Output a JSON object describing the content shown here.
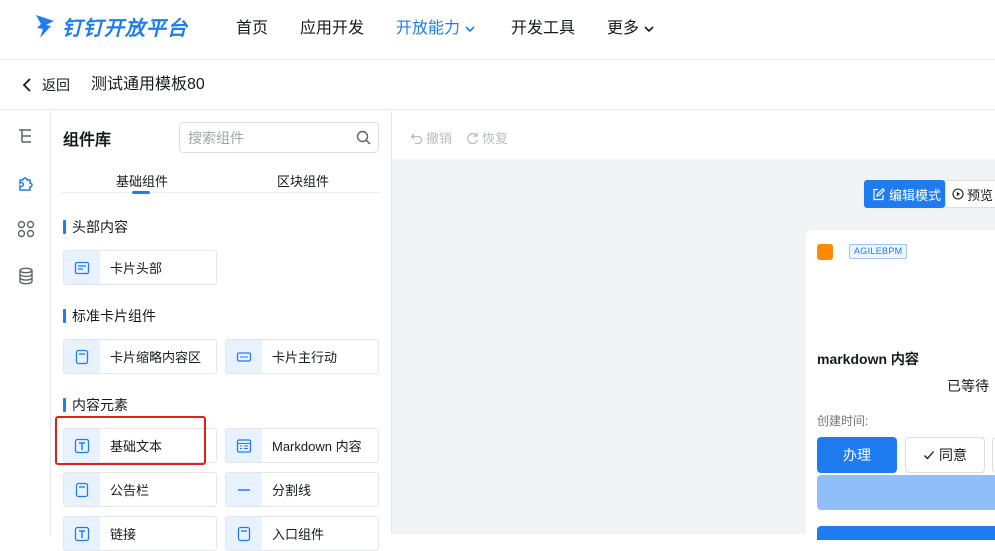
{
  "brand": {
    "name": "钉钉开放平台",
    "color": "#1f7cf0"
  },
  "nav": {
    "items": [
      {
        "label": "首页",
        "active": false
      },
      {
        "label": "应用开发",
        "active": false
      },
      {
        "label": "开放能力",
        "active": true,
        "dropdown": true
      },
      {
        "label": "开发工具",
        "active": false
      },
      {
        "label": "更多",
        "active": false,
        "dropdown": true
      }
    ]
  },
  "subheader": {
    "back_label": "返回",
    "title": "测试通用模板80"
  },
  "rail": {
    "icons": [
      "tree-outline-icon",
      "puzzle-icon",
      "grid-apps-icon",
      "database-icon"
    ]
  },
  "panel": {
    "title": "组件库",
    "search_placeholder": "搜索组件",
    "tabs": [
      {
        "label": "基础组件",
        "active": true
      },
      {
        "label": "区块组件",
        "active": false
      }
    ],
    "sections": [
      {
        "heading": "头部内容",
        "items": [
          {
            "label": "卡片头部",
            "icon": "card-header-icon"
          }
        ]
      },
      {
        "heading": "标准卡片组件",
        "items": [
          {
            "label": "卡片缩略内容区",
            "icon": "card-summary-icon"
          },
          {
            "label": "卡片主行动",
            "icon": "button-icon"
          }
        ]
      },
      {
        "heading": "内容元素",
        "items": [
          {
            "label": "基础文本",
            "icon": "text-icon"
          },
          {
            "label": "Markdown 内容",
            "icon": "markdown-icon"
          },
          {
            "label": "公告栏",
            "icon": "notice-icon"
          },
          {
            "label": "分割线",
            "icon": "divider-icon"
          },
          {
            "label": "链接",
            "icon": "link-icon"
          },
          {
            "label": "入口组件",
            "icon": "entry-icon"
          }
        ]
      }
    ]
  },
  "canvas": {
    "undo_label": "撤销",
    "redo_label": "恢复",
    "edit_mode_label": "编辑模式",
    "preview_label": "预览",
    "card": {
      "tag": "AGILEBPM",
      "title": "markdown 内容",
      "waiting_text": "已等待",
      "created_label": "创建时间:",
      "primary_btn": "办理",
      "agree_btn": "同意"
    }
  },
  "colors": {
    "accent": "#1f7cf0",
    "highlight": "#e0201d",
    "canvas_bg": "#f2f3f5"
  }
}
